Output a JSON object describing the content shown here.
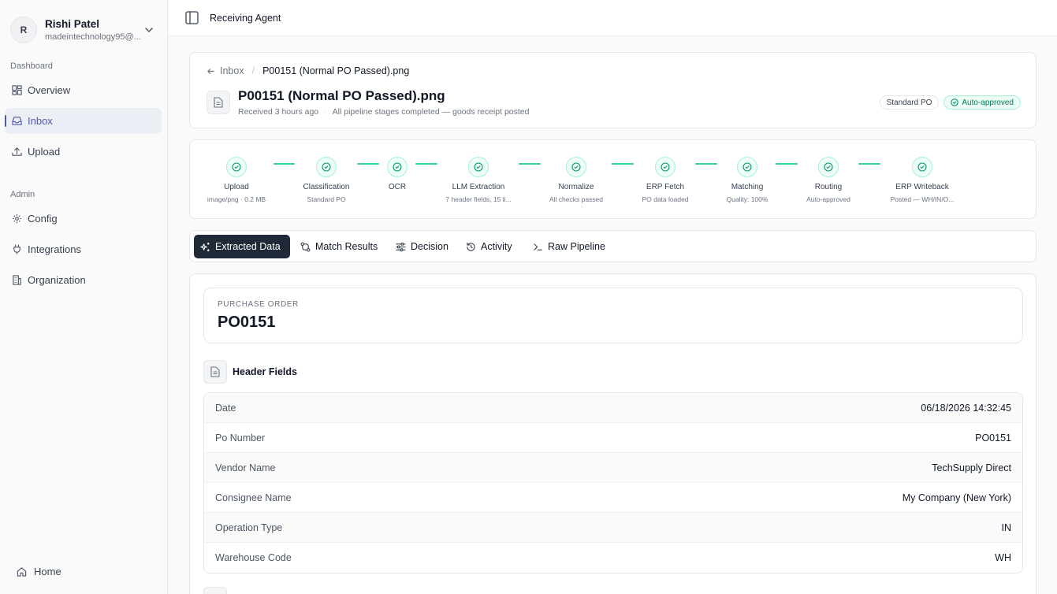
{
  "user": {
    "initial": "R",
    "name": "Rishi Patel",
    "email": "madeintechnology95@..."
  },
  "sidebar": {
    "section_dashboard": "Dashboard",
    "section_admin": "Admin",
    "items": [
      {
        "label": "Overview",
        "icon": "grid-icon"
      },
      {
        "label": "Inbox",
        "icon": "inbox-icon",
        "active": true
      },
      {
        "label": "Upload",
        "icon": "upload-icon"
      },
      {
        "label": "Config",
        "icon": "gear-icon"
      },
      {
        "label": "Integrations",
        "icon": "plug-icon"
      },
      {
        "label": "Organization",
        "icon": "building-icon"
      }
    ],
    "home_label": "Home"
  },
  "topbar": {
    "title": "Receiving Agent"
  },
  "header": {
    "breadcrumb_inbox": "Inbox",
    "breadcrumb_current": "P00151 (Normal PO Passed).png",
    "title": "P00151 (Normal PO Passed).png",
    "received": "Received 3 hours ago",
    "status_text": "All pipeline stages completed — goods receipt posted",
    "badge_type": "Standard PO",
    "badge_status": "Auto-approved"
  },
  "pipeline": [
    {
      "name": "Upload",
      "meta": "image/png · 0.2 MB"
    },
    {
      "name": "Classification",
      "meta": "Standard PO"
    },
    {
      "name": "OCR",
      "meta": ""
    },
    {
      "name": "LLM Extraction",
      "meta": "7 header fields, 15 li..."
    },
    {
      "name": "Normalize",
      "meta": "All checks passed"
    },
    {
      "name": "ERP Fetch",
      "meta": "PO data loaded"
    },
    {
      "name": "Matching",
      "meta": "Quality: 100%"
    },
    {
      "name": "Routing",
      "meta": "Auto-approved"
    },
    {
      "name": "ERP Writeback",
      "meta": "Posted — WH/IN/O..."
    }
  ],
  "tabs": [
    {
      "label": "Extracted Data",
      "icon": "sparkles-icon",
      "active": true
    },
    {
      "label": "Match Results",
      "icon": "git-compare-icon"
    },
    {
      "label": "Decision",
      "icon": "sliders-icon"
    },
    {
      "label": "Activity",
      "icon": "history-icon"
    },
    {
      "label": "Raw Pipeline",
      "icon": "terminal-icon"
    }
  ],
  "extracted": {
    "po_label": "PURCHASE ORDER",
    "po_value": "PO0151",
    "header_fields_title": "Header Fields",
    "fields": [
      {
        "key": "Date",
        "value": "06/18/2026 14:32:45"
      },
      {
        "key": "Po Number",
        "value": "PO0151"
      },
      {
        "key": "Vendor Name",
        "value": "TechSupply Direct"
      },
      {
        "key": "Consignee Name",
        "value": "My Company (New York)"
      },
      {
        "key": "Operation Type",
        "value": "IN"
      },
      {
        "key": "Warehouse Code",
        "value": "WH"
      }
    ]
  },
  "colors": {
    "accent": "#4f5aa8",
    "success": "#10b981",
    "dark": "#1f2937"
  }
}
